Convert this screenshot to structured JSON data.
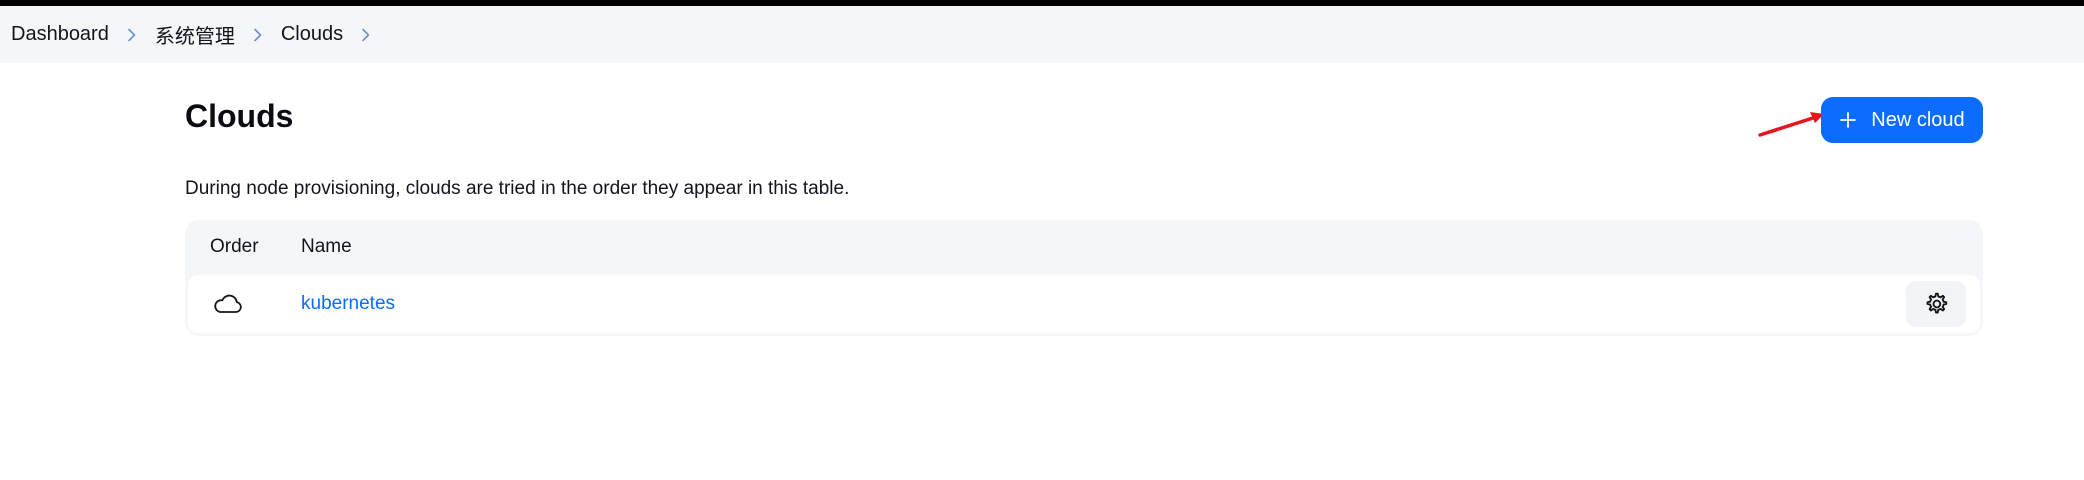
{
  "breadcrumb": {
    "items": [
      {
        "label": "Dashboard"
      },
      {
        "label": "系统管理"
      },
      {
        "label": "Clouds"
      }
    ]
  },
  "header": {
    "title": "Clouds",
    "new_cloud_label": "New cloud",
    "new_cloud_icon": "plus-icon"
  },
  "description": "During node provisioning, clouds are tried in the order they appear in this table.",
  "table": {
    "columns": [
      "Order",
      "Name"
    ],
    "rows": [
      {
        "order_icon": "cloud-icon",
        "name": "kubernetes",
        "action_icon": "gear-icon"
      }
    ]
  },
  "colors": {
    "accent": "#0b6cff",
    "annotation_arrow": "#e8141b",
    "breadcrumb_bg": "#f4f6f8"
  }
}
